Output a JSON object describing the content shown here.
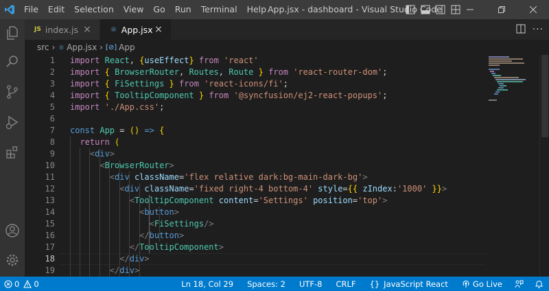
{
  "titlebar": {
    "menu": [
      "File",
      "Edit",
      "Selection",
      "View",
      "Go",
      "Run",
      "Terminal",
      "Help"
    ],
    "window_title": "App.jsx - dashboard - Visual Studio Code"
  },
  "activity_icons": [
    "explorer-icon",
    "search-icon",
    "source-control-icon",
    "run-debug-icon",
    "extensions-icon",
    "account-icon",
    "settings-gear-icon"
  ],
  "tabs": [
    {
      "label": "index.js",
      "icon": "JS",
      "active": false
    },
    {
      "label": "App.jsx",
      "icon": "react",
      "active": true
    }
  ],
  "breadcrumb": {
    "folder": "src",
    "file": "App.jsx",
    "symbol": "App"
  },
  "editor": {
    "line_numbers": [
      "1",
      "2",
      "3",
      "4",
      "5",
      "6",
      "7",
      "8",
      "9",
      "10",
      "11",
      "12",
      "13",
      "14",
      "15",
      "16",
      "17",
      "18",
      "19"
    ],
    "current_line": "18",
    "lines": [
      "import React, {useEffect} from 'react'",
      "import { BrowserRouter, Routes, Route } from 'react-router-dom';",
      "import { FiSettings } from 'react-icons/fi';",
      "import { TooltipComponent } from '@syncfusion/ej2-react-popups';",
      "import './App.css';",
      "",
      "const App = () => {",
      "  return (",
      "    <div>",
      "      <BrowserRouter>",
      "        <div className='flex relative dark:bg-main-dark-bg'>",
      "          <div className='fixed right-4 bottom-4' style={{ zIndex:'1000' }}>",
      "            <TooltipComponent content='Settings' position='top'>",
      "              <button>",
      "                <FiSettings/>",
      "              </button>",
      "            </TooltipComponent>",
      "          </div>",
      "        </div>"
    ]
  },
  "statusbar": {
    "errors": "0",
    "warnings": "0",
    "position": "Ln 18, Col 29",
    "spaces": "Spaces: 2",
    "encoding": "UTF-8",
    "eol": "CRLF",
    "language": "JavaScript React",
    "golive": "Go Live"
  },
  "colors": {
    "statusbar": "#007acc",
    "titlebar": "#3c3c3c",
    "activitybar": "#333333",
    "editor_bg": "#1e1e1e"
  }
}
